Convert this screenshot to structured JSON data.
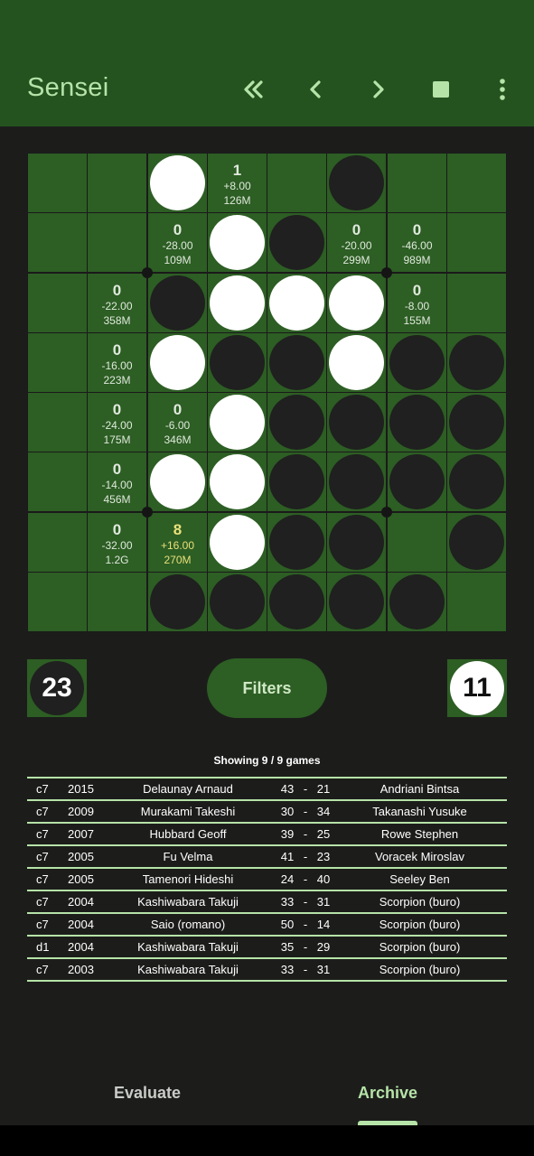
{
  "app": {
    "title": "Sensei",
    "actions": [
      {
        "icon": "first-move-icon"
      },
      {
        "icon": "previous-move-icon"
      },
      {
        "icon": "next-move-icon"
      },
      {
        "icon": "stop-icon"
      },
      {
        "icon": "more-options-icon"
      }
    ]
  },
  "colors": {
    "appbar": "#24531f",
    "board_cell": "#2d5e24",
    "accent": "#b6e3a8",
    "best_move": "#e8e07a",
    "background": "#1c1d1b"
  },
  "board": {
    "rows": [
      "__WM B___",
      "__EWBEE_",
      "_EBWWWE_",
      "_EWBBWBB",
      "_EEWBBBB",
      "_EWWBBBB",
      "_EEWBB_B",
      "__BBBBB_"
    ],
    "evaluations": [
      {
        "row": 0,
        "col": 3,
        "move": "1",
        "score": "+8.00",
        "nodes": "126M",
        "best": false
      },
      {
        "row": 1,
        "col": 2,
        "move": "0",
        "score": "-28.00",
        "nodes": "109M",
        "best": false
      },
      {
        "row": 1,
        "col": 5,
        "move": "0",
        "score": "-20.00",
        "nodes": "299M",
        "best": false
      },
      {
        "row": 1,
        "col": 6,
        "move": "0",
        "score": "-46.00",
        "nodes": "989M",
        "best": false
      },
      {
        "row": 2,
        "col": 1,
        "move": "0",
        "score": "-22.00",
        "nodes": "358M",
        "best": false
      },
      {
        "row": 2,
        "col": 6,
        "move": "0",
        "score": "-8.00",
        "nodes": "155M",
        "best": false
      },
      {
        "row": 3,
        "col": 1,
        "move": "0",
        "score": "-16.00",
        "nodes": "223M",
        "best": false
      },
      {
        "row": 4,
        "col": 1,
        "move": "0",
        "score": "-24.00",
        "nodes": "175M",
        "best": false
      },
      {
        "row": 4,
        "col": 2,
        "move": "0",
        "score": "-6.00",
        "nodes": "346M",
        "best": false
      },
      {
        "row": 5,
        "col": 1,
        "move": "0",
        "score": "-14.00",
        "nodes": "456M",
        "best": false
      },
      {
        "row": 6,
        "col": 1,
        "move": "0",
        "score": "-32.00",
        "nodes": "1.2G",
        "best": false
      },
      {
        "row": 6,
        "col": 2,
        "move": "8",
        "score": "+16.00",
        "nodes": "270M",
        "best": true
      }
    ]
  },
  "score": {
    "black": "23",
    "white": "11"
  },
  "filters_label": "Filters",
  "archive": {
    "showing": "Showing 9 / 9 games",
    "games": [
      {
        "move": "c7",
        "year": "2015",
        "black": "Delaunay Arnaud",
        "black_score": "43",
        "dash": "-",
        "white_score": "21",
        "white": "Andriani Bintsa"
      },
      {
        "move": "c7",
        "year": "2009",
        "black": "Murakami Takeshi",
        "black_score": "30",
        "dash": "-",
        "white_score": "34",
        "white": "Takanashi Yusuke"
      },
      {
        "move": "c7",
        "year": "2007",
        "black": "Hubbard Geoff",
        "black_score": "39",
        "dash": "-",
        "white_score": "25",
        "white": "Rowe Stephen"
      },
      {
        "move": "c7",
        "year": "2005",
        "black": "Fu Velma",
        "black_score": "41",
        "dash": "-",
        "white_score": "23",
        "white": "Voracek Miroslav"
      },
      {
        "move": "c7",
        "year": "2005",
        "black": "Tamenori Hideshi",
        "black_score": "24",
        "dash": "-",
        "white_score": "40",
        "white": "Seeley Ben"
      },
      {
        "move": "c7",
        "year": "2004",
        "black": "Kashiwabara Takuji",
        "black_score": "33",
        "dash": "-",
        "white_score": "31",
        "white": "Scorpion (buro)"
      },
      {
        "move": "c7",
        "year": "2004",
        "black": "Saio (romano)",
        "black_score": "50",
        "dash": "-",
        "white_score": "14",
        "white": "Scorpion (buro)"
      },
      {
        "move": "d1",
        "year": "2004",
        "black": "Kashiwabara Takuji",
        "black_score": "35",
        "dash": "-",
        "white_score": "29",
        "white": "Scorpion (buro)"
      },
      {
        "move": "c7",
        "year": "2003",
        "black": "Kashiwabara Takuji",
        "black_score": "33",
        "dash": "-",
        "white_score": "31",
        "white": "Scorpion (buro)"
      }
    ]
  },
  "tabs": [
    {
      "label": "Evaluate",
      "active": false
    },
    {
      "label": "Archive",
      "active": true
    }
  ]
}
